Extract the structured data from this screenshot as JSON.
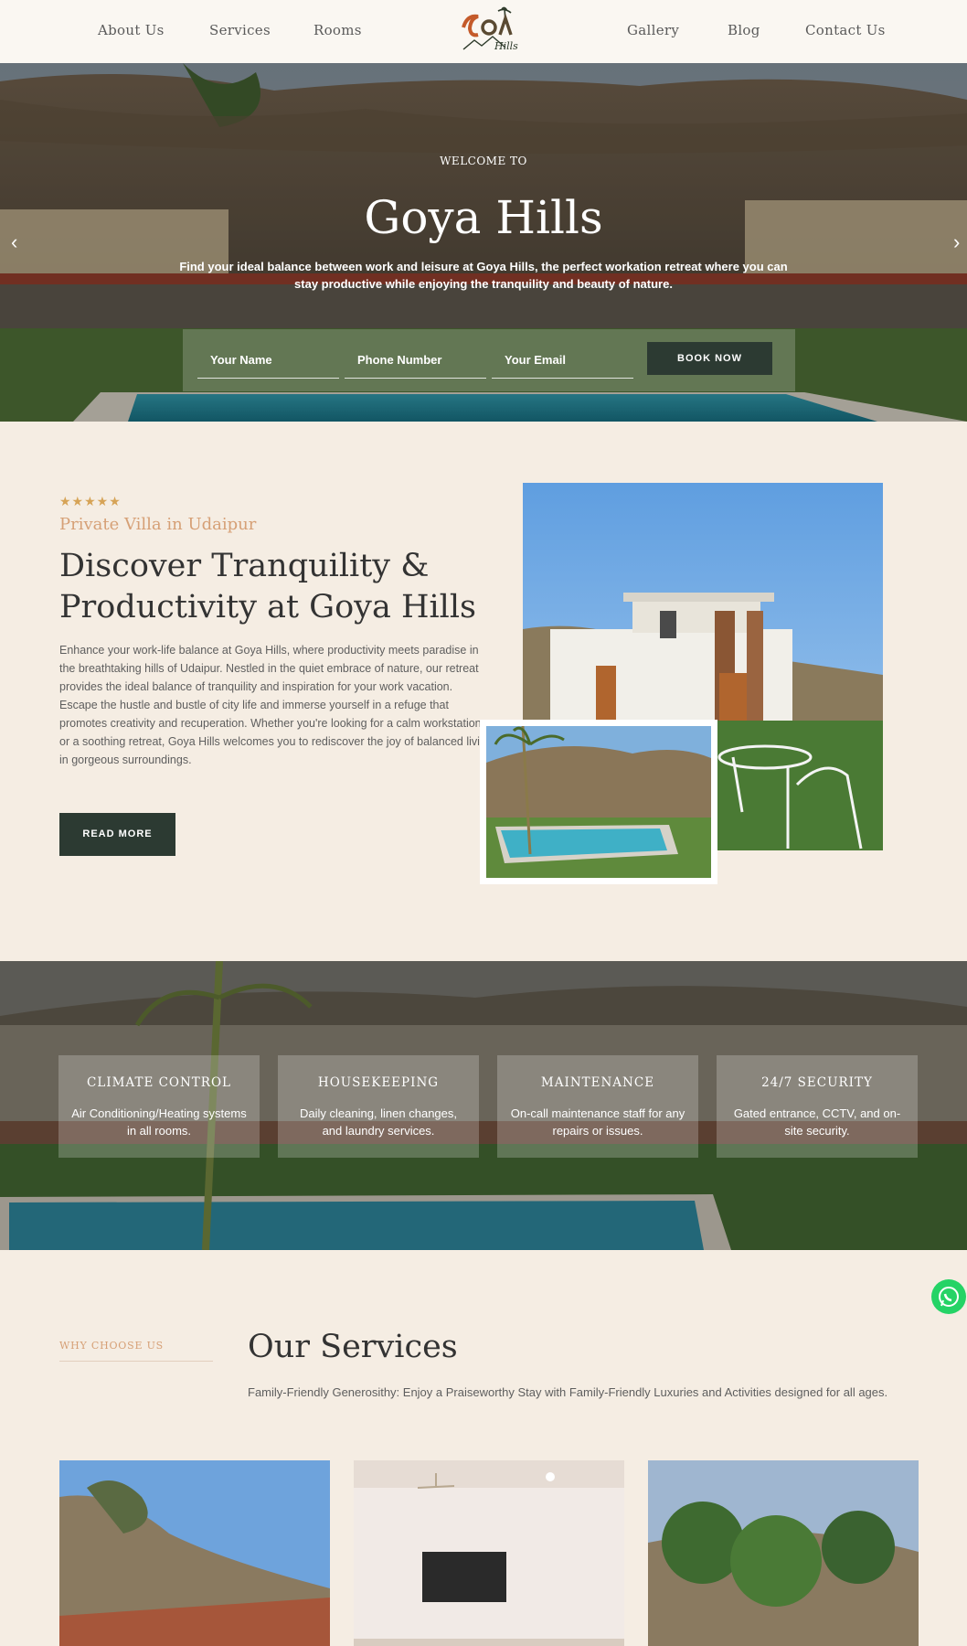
{
  "nav": {
    "links_left": [
      "About Us",
      "Services",
      "Rooms"
    ],
    "links_right": [
      "Gallery",
      "Blog",
      "Contact Us"
    ],
    "logo_text": "GOYA Hills"
  },
  "hero": {
    "welcome": "WELCOME TO",
    "title": "Goya Hills",
    "lead": "Find your ideal balance between work and leisure at Goya Hills, the perfect workation retreat where you can stay productive while enjoying the tranquility and beauty of nature.",
    "prev_icon": "chevron-left-icon",
    "next_icon": "chevron-right-icon",
    "form": {
      "name_placeholder": "Your Name",
      "phone_placeholder": "Phone Number",
      "email_placeholder": "Your Email",
      "button": "BOOK NOW"
    }
  },
  "about": {
    "stars": "★★★★★",
    "kicker": "Private Villa in Udaipur",
    "title": "Discover Tranquility & Productivity at Goya Hills",
    "body": "Enhance your work-life balance at Goya Hills, where productivity meets paradise in the breathtaking hills of Udaipur. Nestled in the quiet embrace of nature, our retreat provides the ideal balance of tranquility and inspiration for your work vacation. Escape the hustle and bustle of city life and immerse yourself in a refuge that promotes creativity and recuperation. Whether you're looking for a calm workstation or a soothing retreat, Goya Hills welcomes you to rediscover the joy of balanced living in gorgeous surroundings.",
    "button": "READ MORE"
  },
  "amenities": [
    {
      "title": "CLIMATE CONTROL",
      "desc": "Air Conditioning/Heating systems in all rooms."
    },
    {
      "title": "HOUSEKEEPING",
      "desc": "Daily cleaning, linen changes, and laundry services."
    },
    {
      "title": "MAINTENANCE",
      "desc": "On-call maintenance staff for any repairs or issues."
    },
    {
      "title": "24/7 SECURITY",
      "desc": "Gated entrance, CCTV, and on-site security."
    }
  ],
  "services": {
    "kicker": "WHY CHOOSE US",
    "title": "Our Services",
    "subtitle": "Family-Friendly Generosithy: Enjoy a Praiseworthy Stay with Family-Friendly Luxuries and Activities designed for all ages."
  },
  "whatsapp_icon": "whatsapp-icon",
  "colors": {
    "background": "#f5ede3",
    "accent_dark": "#2c3a32",
    "accent_gold": "#d6a076"
  }
}
